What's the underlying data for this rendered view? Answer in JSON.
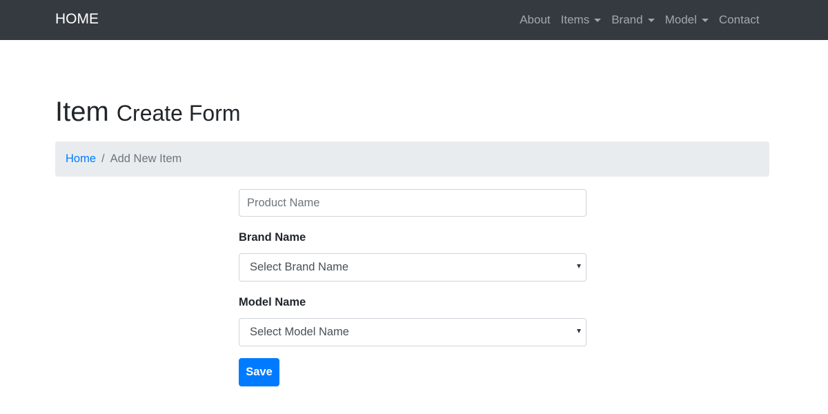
{
  "navbar": {
    "brand": "HOME",
    "items": [
      {
        "label": "About",
        "dropdown": false
      },
      {
        "label": "Items",
        "dropdown": true
      },
      {
        "label": "Brand",
        "dropdown": true
      },
      {
        "label": "Model",
        "dropdown": true
      },
      {
        "label": "Contact",
        "dropdown": false
      }
    ]
  },
  "page": {
    "title": "Item",
    "subtitle": "Create Form"
  },
  "breadcrumb": {
    "home": "Home",
    "separator": "/",
    "current": "Add New Item"
  },
  "form": {
    "product_name": {
      "placeholder": "Product Name",
      "value": ""
    },
    "brand": {
      "label": "Brand Name",
      "selected": "Select Brand Name"
    },
    "model": {
      "label": "Model Name",
      "selected": "Select Model Name"
    },
    "save_label": "Save"
  },
  "colors": {
    "navbar_bg": "#343a40",
    "primary": "#007bff",
    "breadcrumb_bg": "#e9ecef"
  }
}
